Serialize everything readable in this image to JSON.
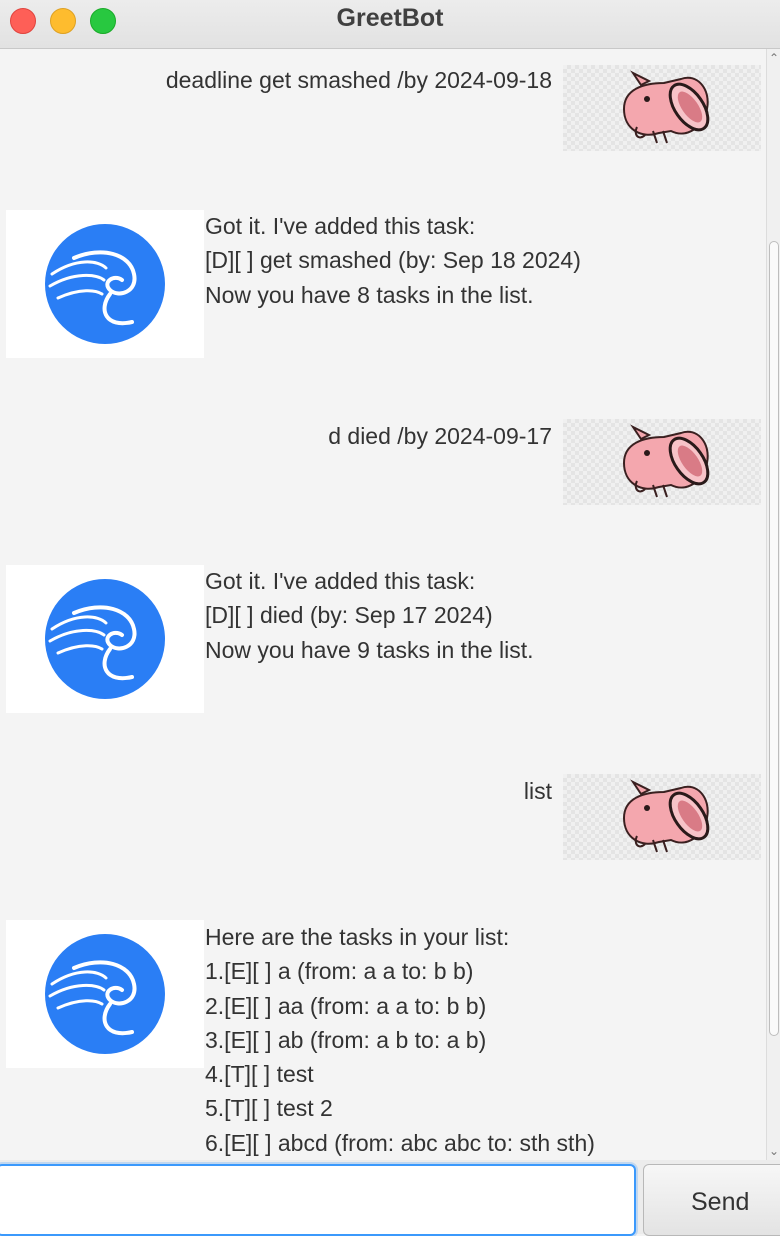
{
  "window": {
    "title": "GreetBot"
  },
  "messages": [
    {
      "sender": "user",
      "text": "deadline get smashed /by 2024-09-18"
    },
    {
      "sender": "bot",
      "text": "Got it. I've added this task:\n[D][ ] get smashed (by: Sep 18 2024)\nNow you have 8 tasks in the list."
    },
    {
      "sender": "user",
      "text": "d died /by 2024-09-17"
    },
    {
      "sender": "bot",
      "text": "Got it. I've added this task:\n[D][ ] died (by: Sep 17 2024)\nNow you have 9 tasks in the list."
    },
    {
      "sender": "user",
      "text": "list"
    },
    {
      "sender": "bot",
      "text": "Here are the tasks in your list:\n1.[E][ ] a (from: a a to: b b)\n2.[E][ ] aa (from: a a to: b b)\n3.[E][ ] ab (from: a b to: a b)\n4.[T][ ] test\n5.[T][ ] test 2\n6.[E][ ] abcd (from: abc abc to: sth sth)"
    }
  ],
  "avatars": {
    "user": "pig-avatar-icon",
    "bot": "dragon-logo-icon"
  },
  "input": {
    "value": "",
    "placeholder": ""
  },
  "send_button": {
    "label": "Send"
  },
  "colors": {
    "accent": "#3b99fc",
    "bot_logo": "#2a7ef5",
    "pig": "#f4a7ae"
  }
}
